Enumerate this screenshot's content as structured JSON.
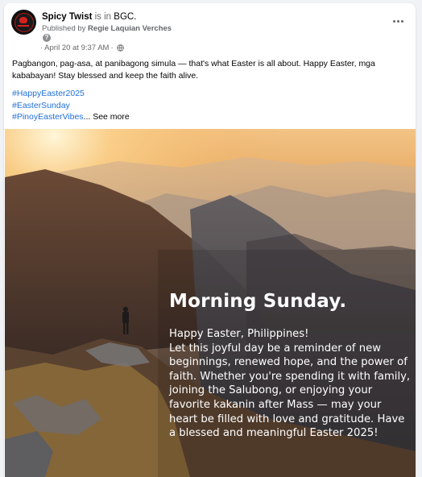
{
  "post": {
    "page_name": "Spicy Twist",
    "is_in": "is in",
    "location": "BGC",
    "location_period": ".",
    "published_by_prefix": "Published by",
    "publisher": "Regie Laquian Verches",
    "date": "April 20 at 9:37 AM",
    "date_separator": "·",
    "caption_line": "Pagbangon, pag-asa, at panibagong simula — that's what Easter is all about. Happy Easter, mga kababayan! Stay blessed and keep the faith alive.",
    "hashtags": [
      "#HappyEaster2025",
      "#EasterSunday",
      "#PinoyEasterVibes"
    ],
    "see_more": "... See more",
    "help_glyph": "?",
    "image": {
      "heading": "Morning Sunday.",
      "body": "Happy Easter, Philippines!\nLet this joyful day be a reminder of new beginnings, renewed hope, and the power of faith. Whether you're spending it with family, joining the Salubong, or enjoying your favorite kakanin after Mass — may your heart be filled with love and gratitude. Have a blessed and meaningful Easter 2025!"
    }
  },
  "icons": {
    "more": "more-options-icon",
    "privacy": "globe-icon",
    "help": "help-icon"
  },
  "colors": {
    "link": "#216fdb",
    "muted": "#65676b",
    "background": "#f0f2f5"
  }
}
